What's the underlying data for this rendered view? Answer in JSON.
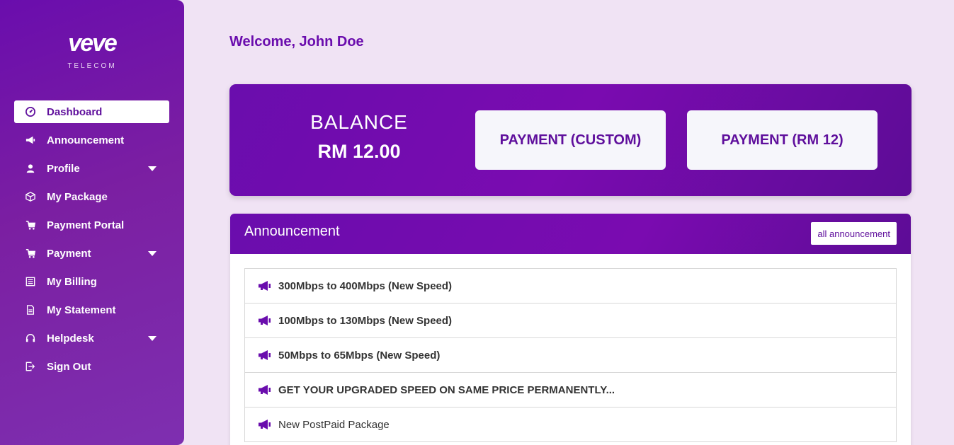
{
  "brand": {
    "logo": "veve",
    "tagline": "TELECOM",
    "accent": "#6a0dad"
  },
  "sidebar": {
    "items": [
      {
        "label": "Dashboard",
        "icon": "dashboard-icon"
      },
      {
        "label": "Announcement",
        "icon": "megaphone-icon"
      },
      {
        "label": "Profile",
        "icon": "user-icon",
        "caret": true
      },
      {
        "label": "My Package",
        "icon": "box-icon"
      },
      {
        "label": "Payment Portal",
        "icon": "cart-icon"
      },
      {
        "label": "Payment",
        "icon": "cart-icon",
        "caret": true
      },
      {
        "label": "My Billing",
        "icon": "list-icon"
      },
      {
        "label": "My Statement",
        "icon": "document-icon"
      },
      {
        "label": "Helpdesk",
        "icon": "headset-icon",
        "caret": true
      },
      {
        "label": "Sign Out",
        "icon": "sign-out-icon"
      }
    ]
  },
  "welcome": "Welcome, John Doe",
  "balance": {
    "label": "BALANCE",
    "value": "RM 12.00",
    "pay_custom": "PAYMENT (CUSTOM)",
    "pay_fixed": "PAYMENT (RM 12)"
  },
  "announcements": {
    "title": "Announcement",
    "all_link": "all announcement",
    "items": [
      "300Mbps to 400Mbps (New Speed)",
      "100Mbps to 130Mbps (New Speed)",
      "50Mbps to 65Mbps (New Speed)",
      "GET YOUR UPGRADED SPEED ON SAME PRICE PERMANENTLY...",
      "New PostPaid Package"
    ]
  }
}
